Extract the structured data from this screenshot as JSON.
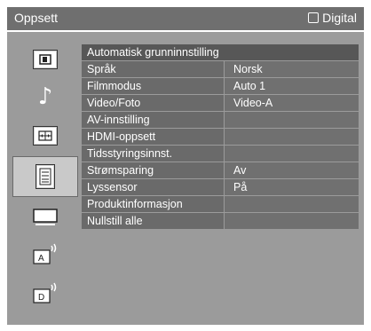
{
  "header": {
    "title": "Oppsett",
    "source_label": "Digital"
  },
  "sidebar": {
    "items": [
      {
        "name": "picture-icon",
        "glyph": "▣"
      },
      {
        "name": "sound-icon",
        "glyph": "♪"
      },
      {
        "name": "screen-icon",
        "glyph": "⊞"
      },
      {
        "name": "setup-icon",
        "glyph": "☰",
        "selected": true
      },
      {
        "name": "monitor-icon",
        "glyph": "▭"
      },
      {
        "name": "analog-antenna-icon",
        "glyph": "A"
      },
      {
        "name": "digital-antenna-icon",
        "glyph": "D"
      }
    ]
  },
  "menu": {
    "rows": [
      {
        "label": "Automatisk grunninnstilling",
        "value": ""
      },
      {
        "label": "Språk",
        "value": "Norsk"
      },
      {
        "label": "Filmmodus",
        "value": "Auto 1"
      },
      {
        "label": "Video/Foto",
        "value": "Video-A"
      },
      {
        "label": "AV-innstilling",
        "value": ""
      },
      {
        "label": "HDMI-oppsett",
        "value": ""
      },
      {
        "label": "Tidsstyringsinnst.",
        "value": ""
      },
      {
        "label": "Strømsparing",
        "value": "Av"
      },
      {
        "label": "Lyssensor",
        "value": "På"
      },
      {
        "label": "Produktinformasjon",
        "value": ""
      },
      {
        "label": "Nullstill alle",
        "value": ""
      }
    ]
  }
}
